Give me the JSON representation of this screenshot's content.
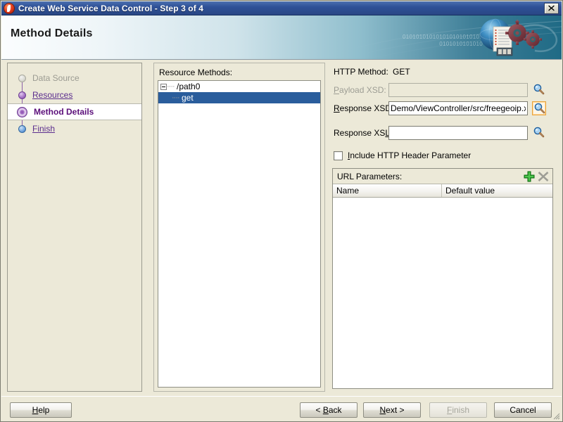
{
  "window": {
    "title": "Create Web Service Data Control - Step 3 of 4",
    "app_icon": "oracle-jdeveloper-icon",
    "close_label": "✖"
  },
  "banner": {
    "heading": "Method Details",
    "binary_line1": "010101010101010101010101",
    "binary_line2": "0101010101010",
    "art_icon": "globe-document-gears-graphic"
  },
  "steps": {
    "items": [
      {
        "label": "Data Source",
        "state": "visited-disabled",
        "bullet": "gray-bullet"
      },
      {
        "label": "Resources",
        "state": "link",
        "bullet": "purple-bullet"
      },
      {
        "label": "Method Details",
        "state": "current",
        "bullet": "purple-ring-bullet"
      },
      {
        "label": "Finish",
        "state": "link",
        "bullet": "blue-bullet"
      }
    ]
  },
  "tree": {
    "label": "Resource Methods:",
    "nodes": [
      {
        "text": "/path0",
        "level": 0,
        "expanded": true,
        "selected": false
      },
      {
        "text": "get",
        "level": 1,
        "expanded": false,
        "selected": true
      }
    ]
  },
  "details": {
    "http_method": {
      "label": "HTTP Method:",
      "value": "GET"
    },
    "payload_xsd": {
      "label": "Payload XSD:",
      "value": "",
      "placeholder": "",
      "disabled": true,
      "browse_icon": "magnifier-icon"
    },
    "response_xsd": {
      "label": "Response XSD:",
      "value": "Demo/ViewController/src/freegeoip.xsd",
      "placeholder": "",
      "disabled": false,
      "browse_icon": "magnifier-icon",
      "browse_focused": true
    },
    "response_xsl": {
      "label": "Response XSL:",
      "value": "",
      "placeholder": "",
      "disabled": false,
      "browse_icon": "magnifier-icon"
    },
    "include_header": {
      "label": "Include HTTP Header Parameter",
      "checked": false
    },
    "url_parameters": {
      "title": "URL Parameters:",
      "add_icon": "green-plus-icon",
      "delete_icon": "gray-x-icon",
      "columns": [
        "Name",
        "Default value"
      ],
      "rows": []
    }
  },
  "footer": {
    "help": "Help",
    "back": "< Back",
    "next": "Next >",
    "finish": "Finish",
    "cancel": "Cancel",
    "finish_disabled": true
  },
  "colors": {
    "titlebar_blue": "#2f5197",
    "selection_blue": "#2a5d9c",
    "dialog_bg": "#ece9d8",
    "step_link": "#5b2d8e",
    "step_active": "#5b0f7a",
    "focus_orange": "#e8a33d",
    "add_green": "#2faa2f"
  }
}
